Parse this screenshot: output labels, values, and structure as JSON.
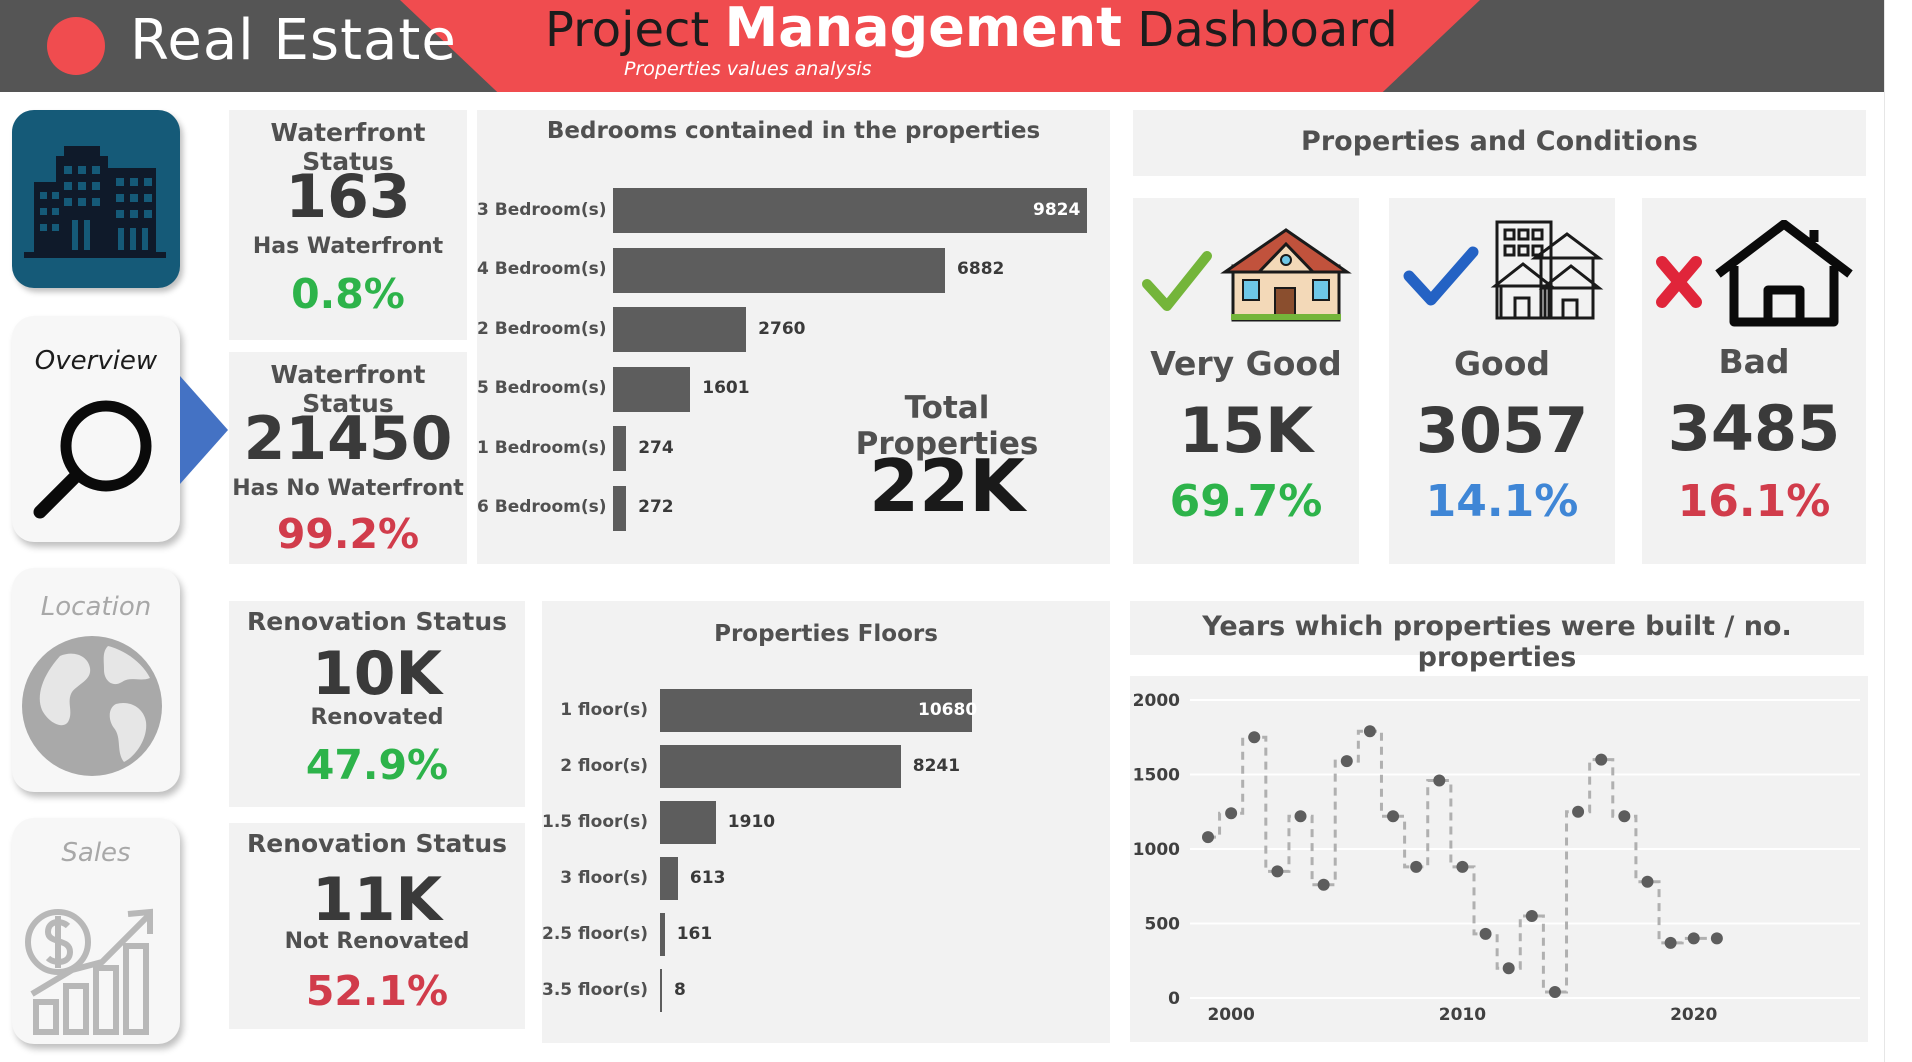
{
  "header": {
    "brand": "Real Estate",
    "title_part1": "Project",
    "title_part2": "Management",
    "title_part3": "Dashboard",
    "subtitle": "Properties values analysis"
  },
  "nav": {
    "items": [
      {
        "label": "Overview",
        "icon": "magnifier-icon",
        "active": true
      },
      {
        "label": "Location",
        "icon": "globe-icon",
        "active": false
      },
      {
        "label": "Sales",
        "icon": "dollar-growth-icon",
        "active": false
      }
    ],
    "logo_icon": "buildings-icon"
  },
  "waterfront": [
    {
      "title": "Waterfront Status",
      "value": "163",
      "label": "Has Waterfront",
      "pct": "0.8%"
    },
    {
      "title": "Waterfront Status",
      "value": "21450",
      "label": "Has No Waterfront",
      "pct": "99.2%"
    }
  ],
  "renovation": [
    {
      "title": "Renovation Status",
      "value": "10K",
      "label": "Renovated",
      "pct": "47.9%"
    },
    {
      "title": "Renovation Status",
      "value": "11K",
      "label": "Not Renovated",
      "pct": "52.1%"
    }
  ],
  "bedrooms": {
    "title": "Bedrooms contained in the properties",
    "total_label": "Total Properties",
    "total_value": "22K"
  },
  "floors": {
    "title": "Properties Floors"
  },
  "conditions": {
    "title": "Properties and Conditions",
    "items": [
      {
        "label": "Very Good",
        "value": "15K",
        "pct": "69.7%",
        "icon": "house-check-icon",
        "color": "#2db34a"
      },
      {
        "label": "Good",
        "value": "3057",
        "pct": "14.1%",
        "icon": "buildings-check-icon",
        "color": "#3f86d6"
      },
      {
        "label": "Bad",
        "value": "3485",
        "pct": "16.1%",
        "icon": "house-cross-icon",
        "color": "#d13c4b"
      }
    ]
  },
  "years": {
    "title": "Years which properties were built / no. properties"
  },
  "chart_data": [
    {
      "type": "bar",
      "title": "Bedrooms contained in the properties",
      "categories": [
        "3 Bedroom(s)",
        "4 Bedroom(s)",
        "2 Bedroom(s)",
        "5 Bedroom(s)",
        "1 Bedroom(s)",
        "6 Bedroom(s)"
      ],
      "values": [
        9824,
        6882,
        2760,
        1601,
        274,
        272
      ],
      "orientation": "horizontal",
      "bar_color": "#5d5d5d",
      "grid": false
    },
    {
      "type": "bar",
      "title": "Properties Floors",
      "categories": [
        "1 floor(s)",
        "2 floor(s)",
        "1.5 floor(s)",
        "3 floor(s)",
        "2.5 floor(s)",
        "3.5 floor(s)"
      ],
      "values": [
        10680,
        8241,
        1910,
        613,
        161,
        8
      ],
      "orientation": "horizontal",
      "bar_color": "#5d5d5d",
      "grid": false
    },
    {
      "type": "line",
      "title": "Years which properties were built / no. properties",
      "style": "step, dashed",
      "x": [
        1999,
        2000,
        2001,
        2002,
        2003,
        2004,
        2005,
        2006,
        2007,
        2008,
        2009,
        2010,
        2011,
        2012,
        2013,
        2014,
        2015,
        2016,
        2017,
        2018,
        2019,
        2020,
        2021
      ],
      "y": [
        1080,
        1240,
        1750,
        850,
        1220,
        760,
        1590,
        1790,
        1220,
        880,
        1460,
        880,
        430,
        200,
        550,
        40,
        1250,
        1600,
        1220,
        780,
        370,
        400,
        400
      ],
      "xticks": [
        "2000",
        "2010",
        "2020"
      ],
      "yticks": [
        "0",
        "500",
        "1000",
        "1500",
        "2000"
      ],
      "xlim": [
        1999,
        2022
      ],
      "ylim": [
        0,
        2000
      ],
      "line_color": "#b0b0b0",
      "marker_color": "#5d5d5d",
      "grid": true
    }
  ]
}
